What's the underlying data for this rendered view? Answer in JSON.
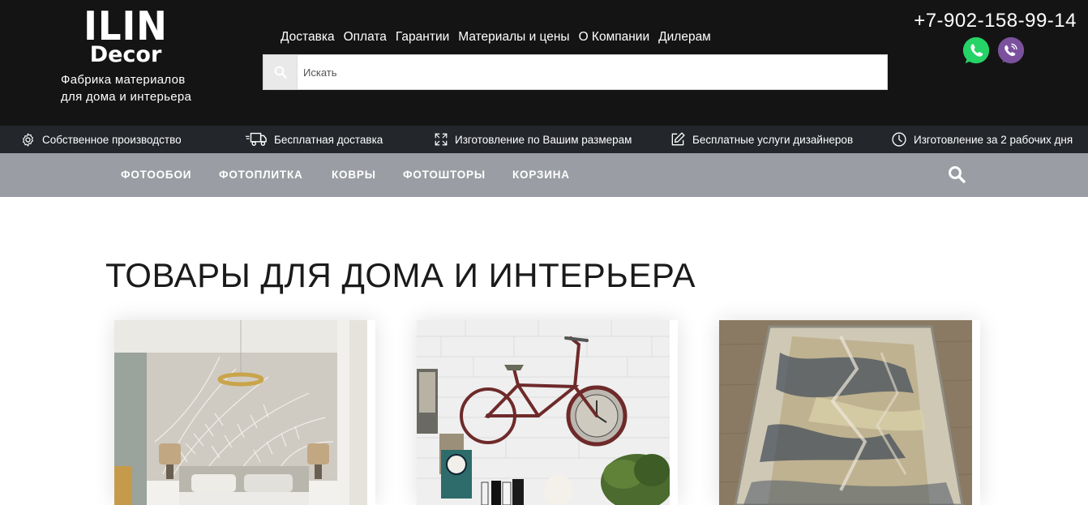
{
  "logo": {
    "line1": "ILIN",
    "line2": "Decor"
  },
  "tagline": {
    "line1": "Фабрика материалов",
    "line2": "для дома и интерьера"
  },
  "topnav": [
    "Доставка",
    "Оплата",
    "Гарантии",
    "Материалы и цены",
    "О Компании",
    "Дилерам"
  ],
  "search": {
    "placeholder": "Искать",
    "icon": "search-icon"
  },
  "phone": "+7-902-158-99-14",
  "messengers": [
    {
      "name": "whatsapp-icon",
      "color": "#25d366"
    },
    {
      "name": "viber-icon",
      "color": "#7b519d"
    }
  ],
  "features": [
    {
      "label": "Собственное производство",
      "icon": "gear-icon"
    },
    {
      "label": "Бесплатная доставка",
      "icon": "truck-icon"
    },
    {
      "label": "Изготовление по Вашим размерам",
      "icon": "resize-icon"
    },
    {
      "label": "Бесплатные услуги дизайнеров",
      "icon": "edit-icon"
    },
    {
      "label": "Изготовление за 2 рабочих дня",
      "icon": "clock-icon"
    }
  ],
  "mainnav": [
    "ФОТООБОИ",
    "ФОТОПЛИТКА",
    "КОВРЫ",
    "ФОТОШТОРЫ",
    "КОРЗИНА"
  ],
  "page_title": "ТОВАРЫ ДЛЯ ДОМА И ИНТЕРЬЕРА",
  "products": [
    {
      "image": "bedroom-wallpaper-photo"
    },
    {
      "image": "bicycle-wall-decor-photo"
    },
    {
      "image": "carpet-photo"
    }
  ],
  "colors": {
    "header_bg": "#141414",
    "features_bg": "#23262b",
    "nav_bg": "#9a9da3"
  }
}
